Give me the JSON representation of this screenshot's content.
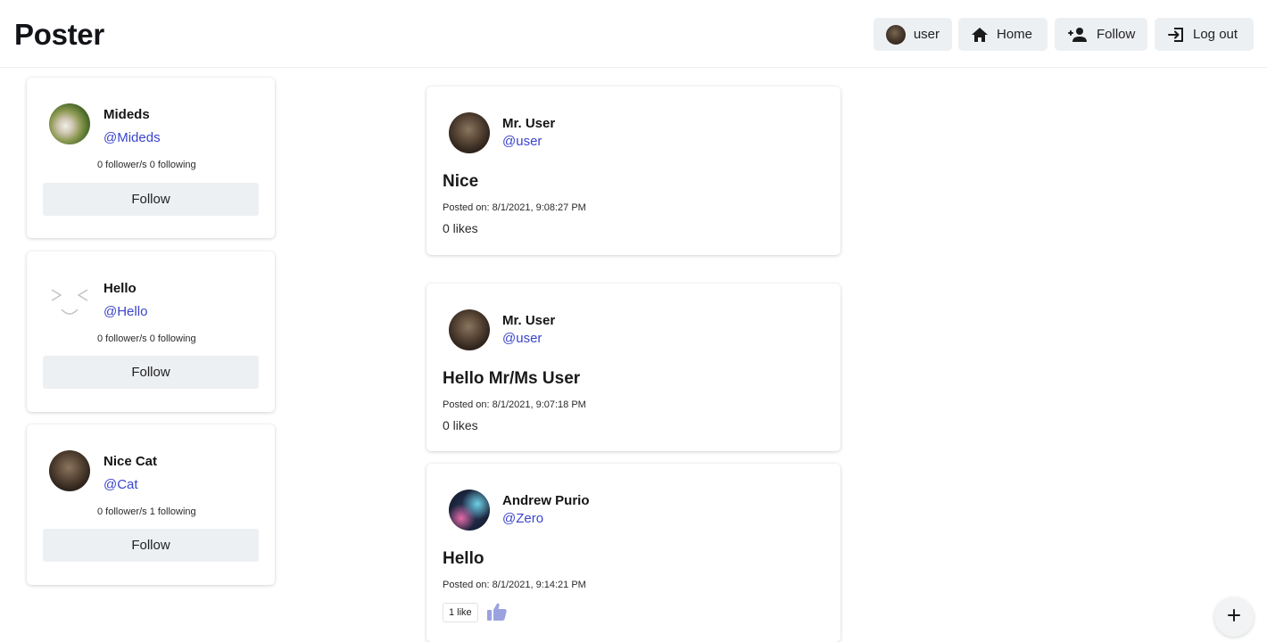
{
  "app": {
    "title": "Poster"
  },
  "nav": {
    "profile_label": "user",
    "home_label": "Home",
    "follow_label": "Follow",
    "logout_label": "Log out"
  },
  "suggestions": [
    {
      "name": "Mideds",
      "handle": "@Mideds",
      "stats": "0 follower/s  0 following",
      "button": "Follow"
    },
    {
      "name": "Hello",
      "handle": "@Hello",
      "stats": "0 follower/s  0 following",
      "button": "Follow"
    },
    {
      "name": "Nice Cat",
      "handle": "@Cat",
      "stats": "0 follower/s  1 following",
      "button": "Follow"
    }
  ],
  "posts": [
    {
      "author": "Mr. User",
      "handle": "@user",
      "title": "Nice",
      "posted": "Posted on: 8/1/2021, 9:08:27 PM",
      "likes": "0 likes"
    },
    {
      "author": "Mr. User",
      "handle": "@user",
      "title": "Hello Mr/Ms User",
      "posted": "Posted on: 8/1/2021, 9:07:18 PM",
      "likes": "0 likes"
    },
    {
      "author": "Andrew Purio",
      "handle": "@Zero",
      "title": "Hello",
      "posted": "Posted on: 8/1/2021, 9:14:21 PM",
      "likes": "1 like"
    }
  ],
  "fab_label": "+",
  "icons": {
    "home": "home-icon",
    "follow": "person-add-icon",
    "logout": "logout-icon",
    "like": "thumb-up-icon",
    "add": "plus-icon"
  },
  "colors": {
    "handle": "#3b44cc",
    "button_bg": "#edf0f3",
    "like_icon": "#9aa3e0"
  }
}
